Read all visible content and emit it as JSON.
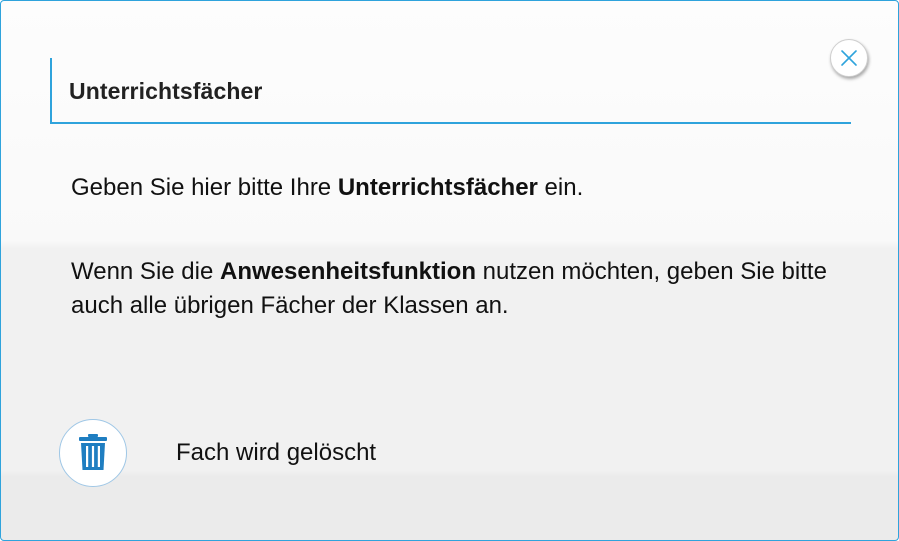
{
  "dialog": {
    "title": "Unterrichtsfächer",
    "close_icon": "close-icon",
    "paragraph1": {
      "before": "Geben Sie hier bitte Ihre ",
      "bold": "Unterrichtsfächer",
      "after": " ein."
    },
    "paragraph2": {
      "before": "Wenn Sie die ",
      "bold": "Anwesenheitsfunktion",
      "after": " nutzen möchten, geben Sie bitte auch alle übrigen Fächer der Klassen an."
    },
    "legend": {
      "icon": "trash-icon",
      "label": "Fach wird gelöscht"
    }
  },
  "colors": {
    "accent": "#2fa3dc",
    "icon_blue": "#1f7ec1"
  }
}
